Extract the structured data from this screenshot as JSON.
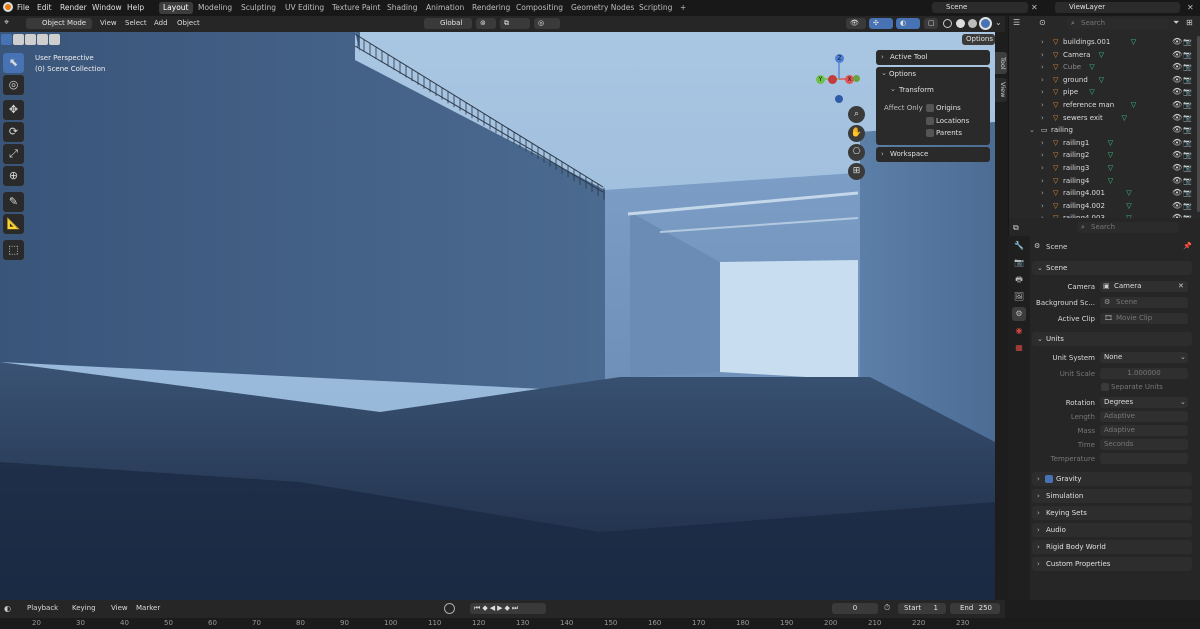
{
  "menus": [
    "File",
    "Edit",
    "Render",
    "Window",
    "Help"
  ],
  "workspaces": [
    "Layout",
    "Modeling",
    "Sculpting",
    "UV Editing",
    "Texture Paint",
    "Shading",
    "Animation",
    "Rendering",
    "Compositing",
    "Geometry Nodes",
    "Scripting",
    "+"
  ],
  "scene_name": "Scene",
  "view_layer": "ViewLayer",
  "viewport_header": {
    "mode": "Object Mode",
    "menus": [
      "View",
      "Select",
      "Add",
      "Object"
    ],
    "transform_orientation": "Global",
    "options": "Options"
  },
  "overlay_text": {
    "line1": "User Perspective",
    "line2": "(0) Scene Collection"
  },
  "gizmo": {
    "z": "Z",
    "y": "Y",
    "x": "X"
  },
  "npanel": {
    "active_tool": "Active Tool",
    "options": "Options",
    "transform": "Transform",
    "affect_only": "Affect Only",
    "origins": "Origins",
    "locations": "Locations",
    "parents": "Parents",
    "workspace": "Workspace",
    "tabs": [
      "Tool",
      "View"
    ]
  },
  "outliner": {
    "search_placeholder": "Search",
    "rows": [
      {
        "name": "buildings.001",
        "indent": 1
      },
      {
        "name": "Camera",
        "indent": 1
      },
      {
        "name": "Cube",
        "indent": 1,
        "dim": true
      },
      {
        "name": "ground",
        "indent": 1
      },
      {
        "name": "pipe",
        "indent": 1
      },
      {
        "name": "reference man",
        "indent": 1
      },
      {
        "name": "sewers exit",
        "indent": 1
      },
      {
        "name": "railing",
        "indent": 0,
        "collection": true
      },
      {
        "name": "railing1",
        "indent": 1
      },
      {
        "name": "railing2",
        "indent": 1
      },
      {
        "name": "railing3",
        "indent": 1
      },
      {
        "name": "railing4",
        "indent": 1
      },
      {
        "name": "railing4.001",
        "indent": 1
      },
      {
        "name": "railing4.002",
        "indent": 1
      },
      {
        "name": "railing4.003",
        "indent": 1
      }
    ]
  },
  "properties": {
    "search_placeholder": "Search",
    "breadcrumb": "Scene",
    "scene_section": "Scene",
    "camera_label": "Camera",
    "camera_value": "Camera",
    "bg_scene_label": "Background Sc...",
    "bg_scene_placeholder": "Scene",
    "active_clip_label": "Active Clip",
    "active_clip_placeholder": "Movie Clip",
    "units_section": "Units",
    "unit_system_label": "Unit System",
    "unit_system_value": "None",
    "unit_scale_label": "Unit Scale",
    "unit_scale_value": "1.000000",
    "separate_units": "Separate Units",
    "rotation_label": "Rotation",
    "rotation_value": "Degrees",
    "length_label": "Length",
    "length_value": "Adaptive",
    "mass_label": "Mass",
    "mass_value": "Adaptive",
    "time_label": "Time",
    "time_value": "Seconds",
    "temperature_label": "Temperature",
    "collapsed": [
      "Gravity",
      "Simulation",
      "Keying Sets",
      "Audio",
      "Rigid Body World",
      "Custom Properties"
    ]
  },
  "timeline": {
    "menus": [
      "Playback",
      "Keying",
      "View",
      "Marker"
    ],
    "current_frame": "0",
    "start_label": "Start",
    "start_value": "1",
    "end_label": "End",
    "end_value": "250"
  },
  "ruler": [
    "20",
    "30",
    "40",
    "50",
    "60",
    "70",
    "80",
    "90",
    "100",
    "110",
    "120",
    "130",
    "140",
    "150",
    "160",
    "170",
    "180",
    "190",
    "200",
    "210",
    "220",
    "230"
  ]
}
